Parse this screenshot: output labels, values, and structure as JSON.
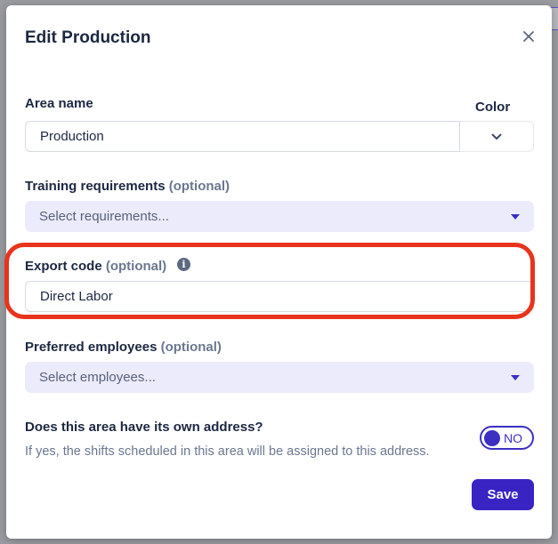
{
  "dialog": {
    "title": "Edit Production",
    "close_icon": "close-icon"
  },
  "area_name": {
    "label": "Area name",
    "value": "Production"
  },
  "color": {
    "label": "Color",
    "icon": "chevron-down-icon"
  },
  "training": {
    "label": "Training requirements",
    "optional": "(optional)",
    "placeholder": "Select requirements..."
  },
  "export_code": {
    "label": "Export code",
    "optional": "(optional)",
    "value": "Direct Labor",
    "info_icon": "info-icon"
  },
  "preferred": {
    "label": "Preferred employees",
    "optional": "(optional)",
    "placeholder": "Select employees..."
  },
  "address": {
    "question": "Does this area have its own address?",
    "description": "If yes, the shifts scheduled in this area will be assigned to this address.",
    "toggle_label": "NO"
  },
  "actions": {
    "save_label": "Save"
  },
  "colors": {
    "accent": "#3a23c3",
    "highlight": "#e8341c",
    "select_bg": "#ecebfb"
  }
}
